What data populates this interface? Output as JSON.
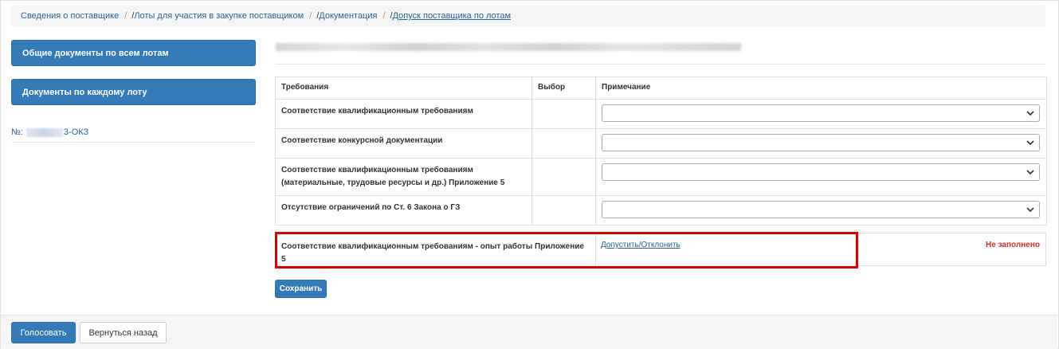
{
  "breadcrumb": [
    {
      "label": "Сведения о поставщике",
      "prefix": ""
    },
    {
      "label": "Лоты для участия в закупке поставщиком",
      "prefix": "/ "
    },
    {
      "label": "Документация",
      "prefix": "/ "
    },
    {
      "label": "Допуск поставщика по лотам",
      "prefix": "/ "
    }
  ],
  "sidebar": {
    "btn_common": "Общие документы по всем лотам",
    "btn_each": "Документы по каждому лоту",
    "lot_prefix": "№:",
    "lot_suffix": "3-ОКЗ"
  },
  "table": {
    "headers": [
      "Требования",
      "Выбор",
      "Примечание"
    ],
    "rows": [
      "Соответствие квалификационным требованиям",
      "Соответствие конкурсной документации",
      "Соответствие квалификационным требованиям (материальные, трудовые ресурсы и др.) Приложение 5",
      "Отсутствие ограничений по Ст. 6 Закона о ГЗ"
    ]
  },
  "experience": {
    "text": "Соответствие квалификационным требованиям - опыт работы Приложение 5",
    "link": "Допустить/Отклонить",
    "status": "Не заполнено"
  },
  "buttons": {
    "save": "Сохранить",
    "vote": "Голосовать",
    "back": "Вернуться назад"
  },
  "colors": {
    "primary": "#337ab7",
    "link": "#2a6496",
    "highlight": "#d40000",
    "status": "#c9302c"
  },
  "icons": [
    "chevron-down-icon"
  ]
}
